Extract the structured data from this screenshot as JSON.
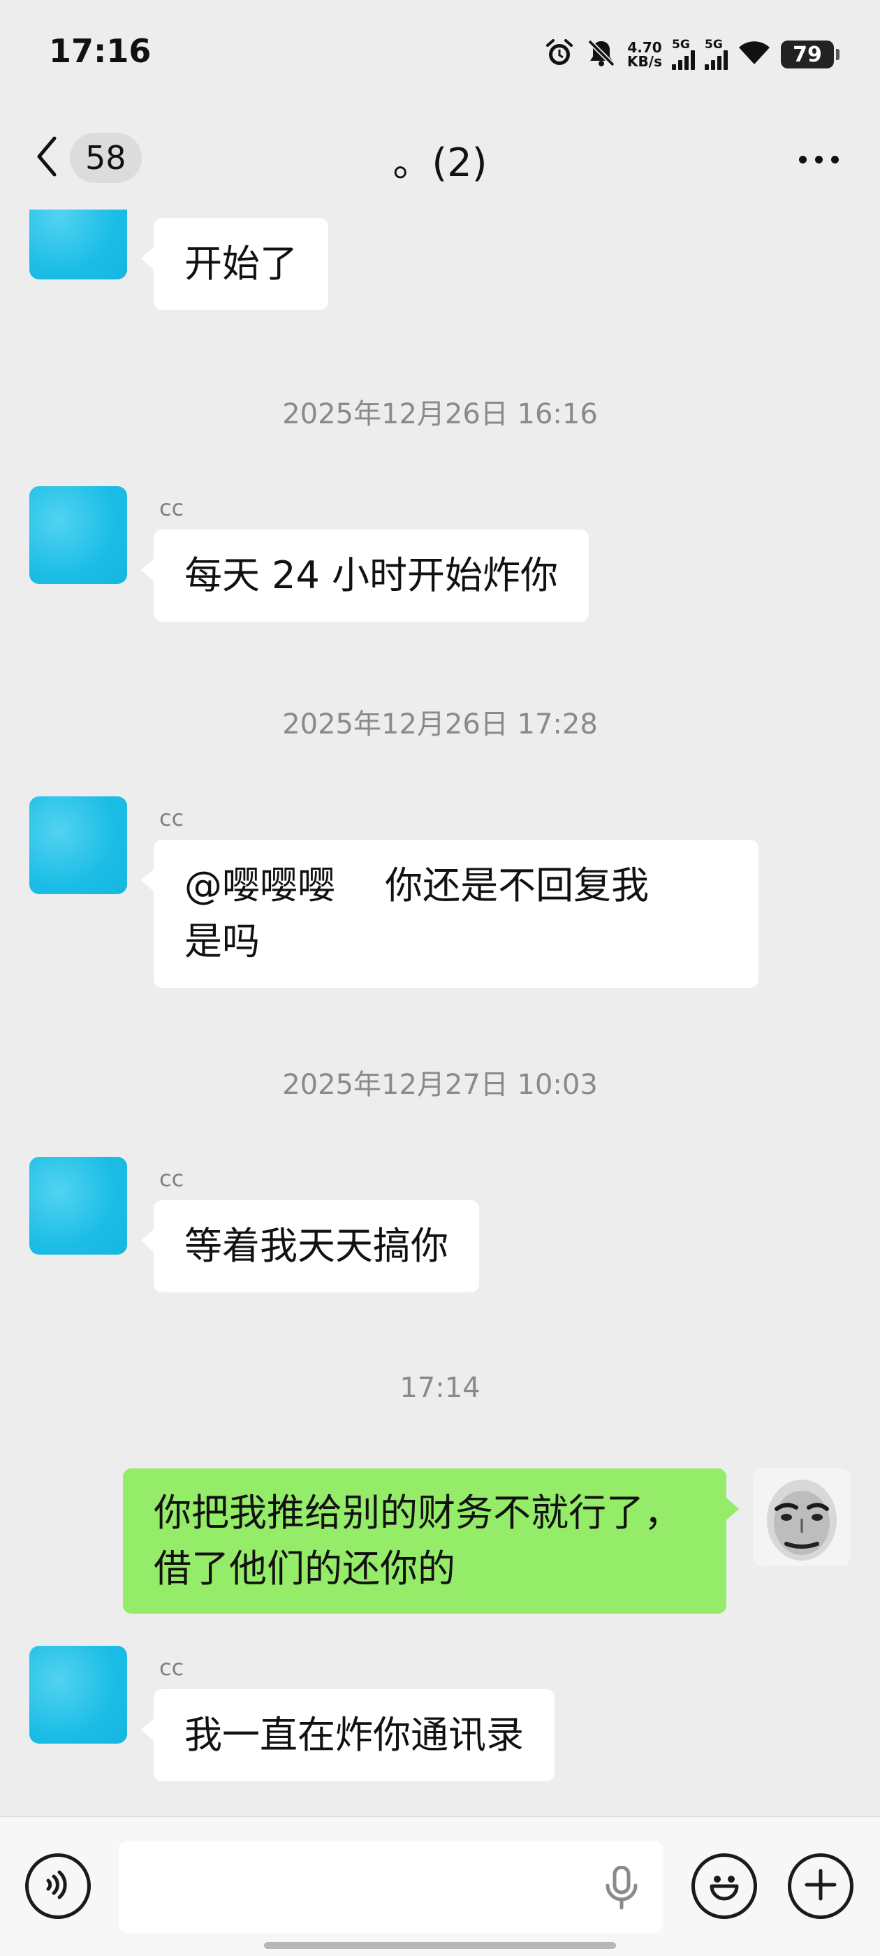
{
  "status_bar": {
    "time": "17:16",
    "net_speed_value": "4.70",
    "net_speed_unit": "KB/s",
    "signal1_label": "5G",
    "signal2_label": "5G",
    "battery": "79",
    "icons": [
      "alarm-icon",
      "mute-icon",
      "signal-icon",
      "wifi-icon",
      "battery-icon"
    ]
  },
  "header": {
    "unread_count": "58",
    "title": "。(2)"
  },
  "messages": {
    "m0": {
      "text": "开始了"
    },
    "t1": "2025年12月26日 16:16",
    "m1": {
      "sender": "cc",
      "text": "每天 24 小时开始炸你"
    },
    "t2": "2025年12月26日 17:28",
    "m2": {
      "sender": "cc",
      "line1": "@嘤嘤嘤　 你还是不回复我",
      "line2": "是吗"
    },
    "t3": "2025年12月27日 10:03",
    "m3": {
      "sender": "cc",
      "text": "等着我天天搞你"
    },
    "t4": "17:14",
    "m4": {
      "line1": "你把我推给别的财务不就行了，",
      "line2": "借了他们的还你的"
    },
    "m5": {
      "sender": "cc",
      "text": "我一直在炸你通讯录"
    }
  },
  "input_bar": {
    "value": "",
    "icons": [
      "voice-mode-icon",
      "microphone-icon",
      "emoji-icon",
      "plus-icon"
    ]
  },
  "colors": {
    "background": "#ededed",
    "incoming_bubble": "#ffffff",
    "outgoing_bubble": "#95ec69",
    "avatar_blue": "#1bbde6",
    "timestamp_text": "#8a8a8a"
  }
}
